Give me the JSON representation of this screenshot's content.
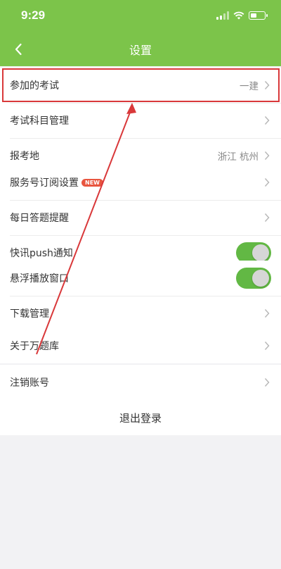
{
  "status_bar": {
    "time": "9:29"
  },
  "nav": {
    "title": "设置"
  },
  "groups": [
    [
      {
        "label": "参加的考试",
        "value": "一建"
      },
      {
        "label": "考试科目管理"
      },
      {
        "label": "报考地",
        "value": "浙江 杭州"
      }
    ],
    [
      {
        "label": "服务号订阅设置",
        "badge": "NEW"
      },
      {
        "label": "每日答题提醒"
      },
      {
        "label": "快讯push通知",
        "toggle_on": true
      }
    ],
    [
      {
        "label": "悬浮播放窗口",
        "toggle_on": true
      },
      {
        "label": "下载管理"
      }
    ],
    [
      {
        "label": "关于万题库"
      }
    ],
    [
      {
        "label": "注销账号"
      }
    ]
  ],
  "logout": {
    "label": "退出登录"
  },
  "colors": {
    "nav_green": "#7cc44a",
    "toggle_green": "#62b844",
    "annotation_red": "#d9383a",
    "badge_red": "#e8553f"
  }
}
